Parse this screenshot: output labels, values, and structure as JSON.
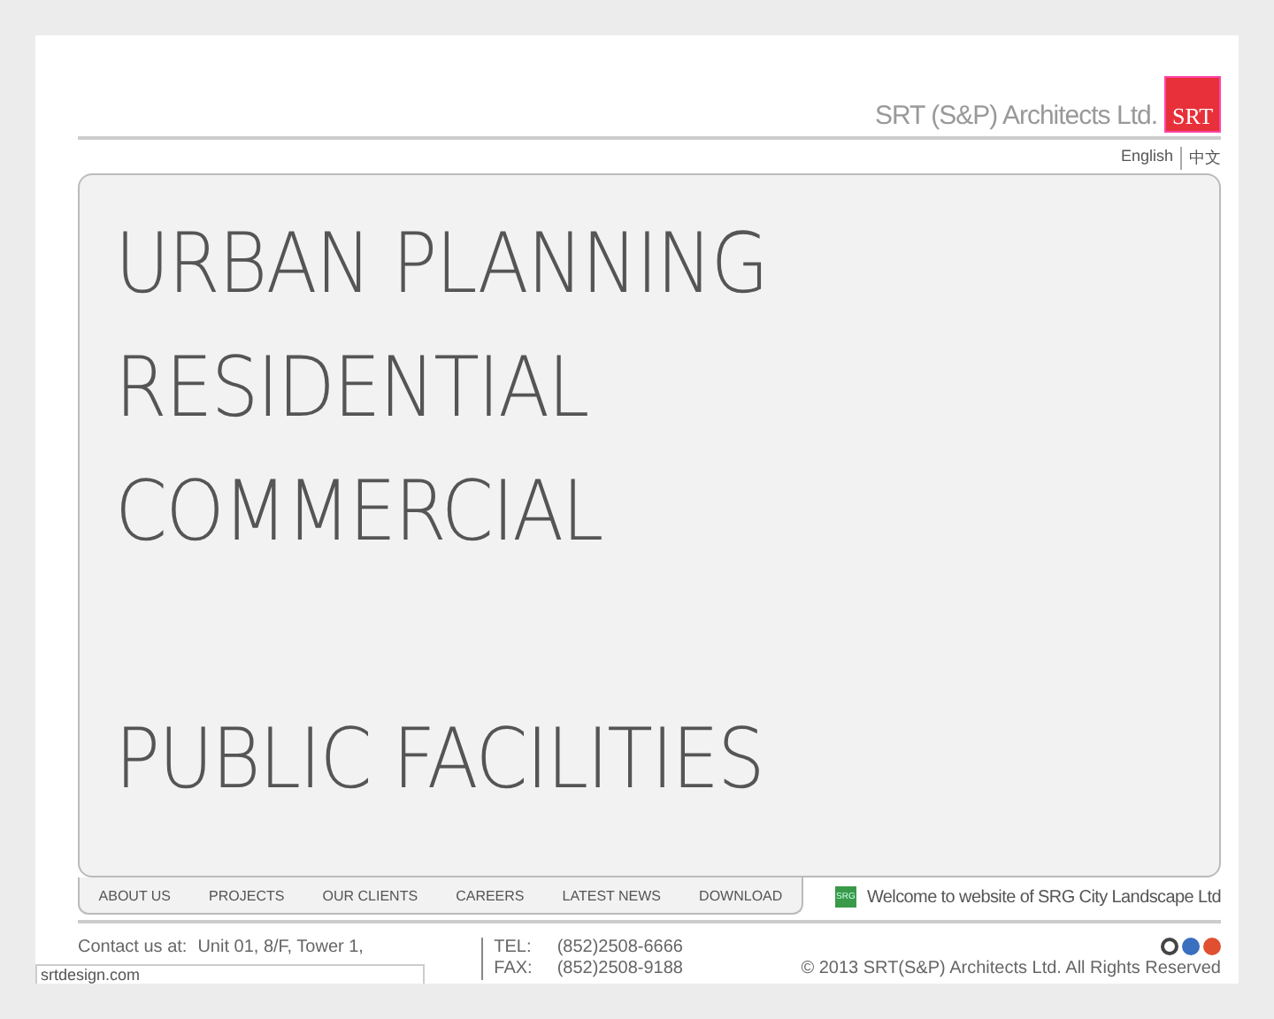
{
  "header": {
    "company": "SRT (S&P) Architects Ltd.",
    "logo": "SRT",
    "languages": [
      "English",
      "中文"
    ]
  },
  "service_groups": [
    [
      "URBAN PLANNING",
      "RESIDENTIAL",
      "COMMERCIAL"
    ],
    [
      "PUBLIC FACILITIES"
    ]
  ],
  "nav": [
    "ABOUT US",
    "PROJECTS",
    "OUR CLIENTS",
    "CAREERS",
    "LATEST NEWS",
    "DOWNLOAD"
  ],
  "welcome": {
    "badge": "SRG",
    "text": "Welcome to website of SRG City Landscape Ltd"
  },
  "footer": {
    "contact_label": "Contact us at:",
    "address": "Unit 01, 8/F, Tower 1,",
    "tel_label": "TEL:",
    "tel": "(852)2508-6666",
    "fax_label": "FAX:",
    "fax": "(852)2508-9188",
    "copyright": "© 2013 SRT(S&P) Architects Ltd. All Rights Reserved"
  },
  "status_bar": "srtdesign.com"
}
